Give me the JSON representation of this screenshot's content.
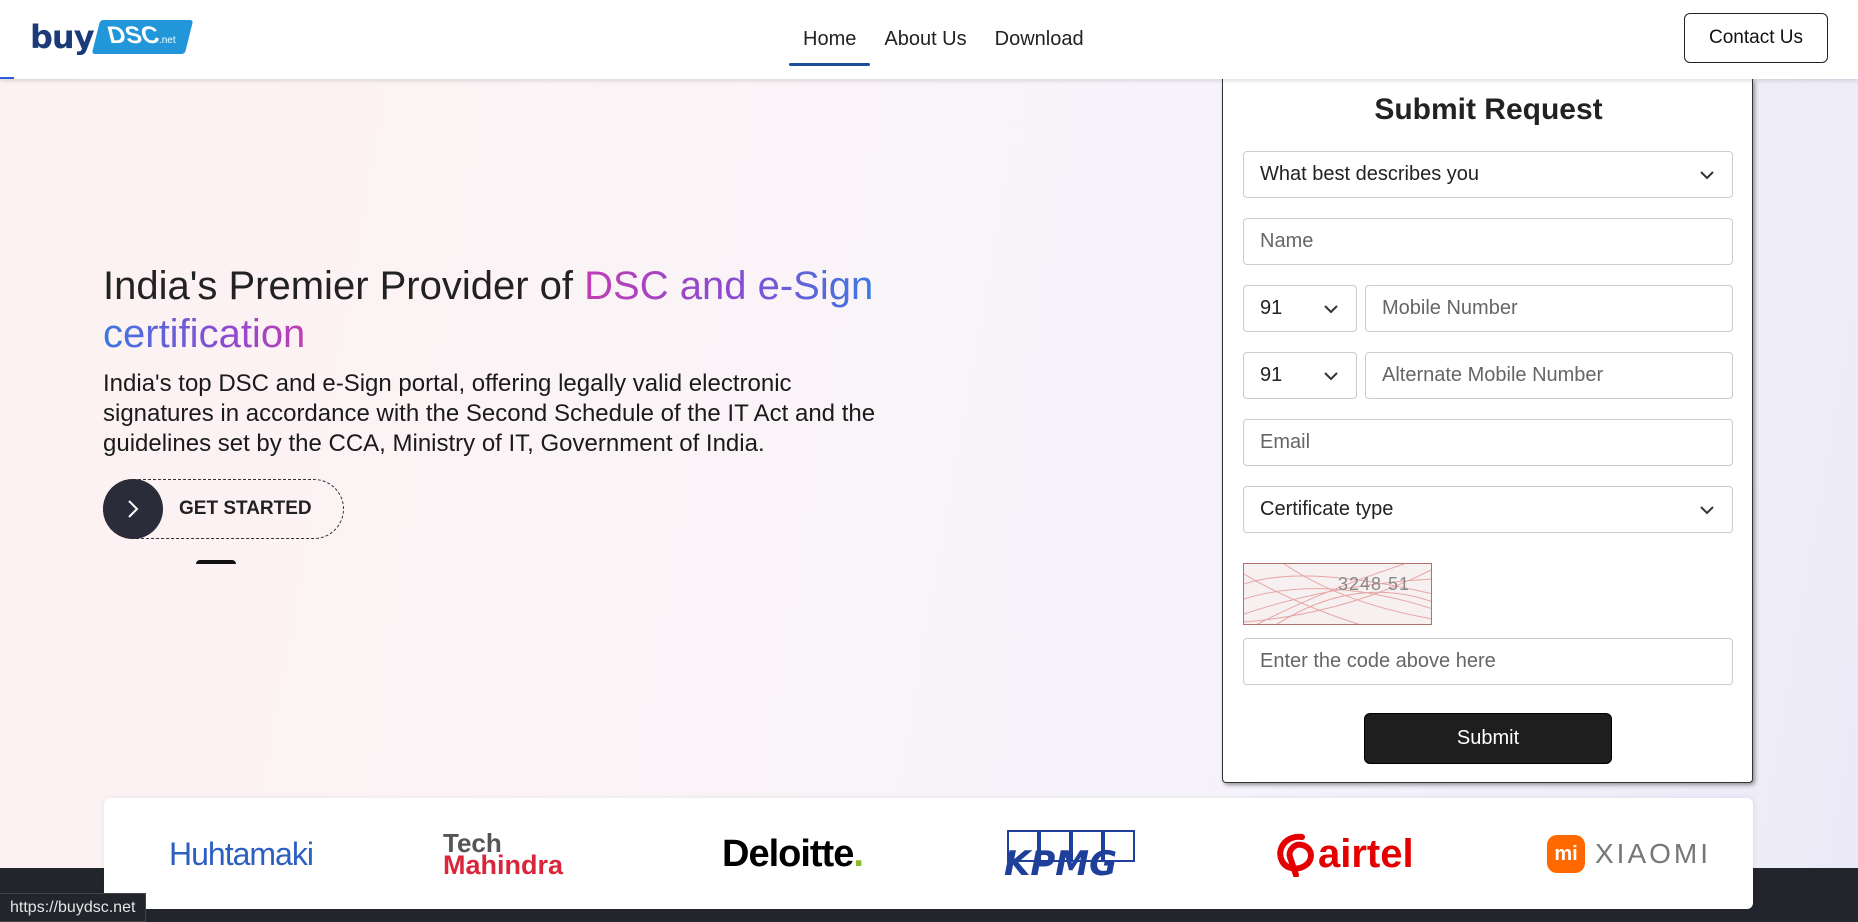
{
  "header": {
    "logo": {
      "buy": "buy",
      "dsc": "DSC",
      "net": ".net"
    },
    "nav": [
      {
        "label": "Home",
        "active": true
      },
      {
        "label": "About Us",
        "active": false
      },
      {
        "label": "Download",
        "active": false
      }
    ],
    "contact_label": "Contact Us"
  },
  "hero": {
    "title_plain": "India's Premier Provider of ",
    "title_highlight_1": "DSC and e-Sign",
    "title_highlight_2": "certification",
    "description": "India's top DSC and e-Sign portal, offering legally valid electronic signatures in accordance with the Second Schedule of the IT Act and the guidelines set by the CCA, Ministry of IT, Government of India.",
    "cta_label": "GET STARTED"
  },
  "form": {
    "title": "Submit Request",
    "describes_select": "What best describes you",
    "name_placeholder": "Name",
    "country_code_1": "91",
    "mobile_placeholder": "Mobile Number",
    "country_code_2": "91",
    "alt_mobile_placeholder": "Alternate Mobile Number",
    "email_placeholder": "Email",
    "certificate_select": "Certificate type",
    "captcha_text": "3248 51",
    "captcha_placeholder": "Enter the code above here",
    "submit_label": "Submit"
  },
  "partners": {
    "huhtamaki_1": "Huhta",
    "huhtamaki_2": "maki",
    "tech_1": "Tech",
    "tech_2": "Mahindra",
    "deloitte": "Deloitte",
    "deloitte_dot": ".",
    "kpmg": "KPMG",
    "airtel": "airtel",
    "xiaomi_mark": "mi",
    "xiaomi": "XIAOMI"
  },
  "status_url": "https://buydsc.net",
  "colors": {
    "accent": "#1b4f9c",
    "gradient_start": "#c13eb4",
    "gradient_end": "#3b78e0",
    "submit_bg": "#1e1e1e",
    "airtel_red": "#e40000",
    "xiaomi_orange": "#ff6900"
  }
}
